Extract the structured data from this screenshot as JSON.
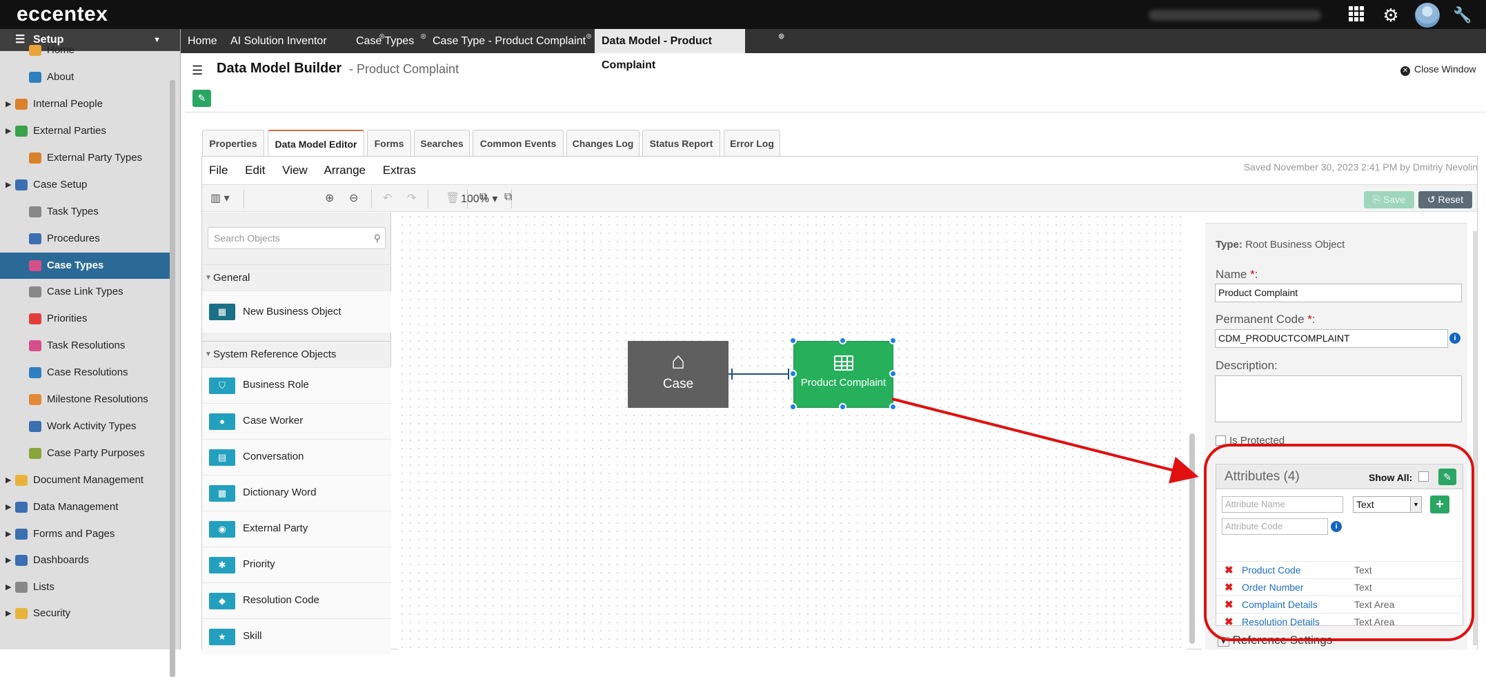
{
  "app": {
    "logo": "eccentex"
  },
  "sidebar": {
    "header": "Setup",
    "items": [
      {
        "label": "Home",
        "color": "#e8a33a"
      },
      {
        "label": "About",
        "color": "#2f7fc0"
      },
      {
        "label": "Internal People",
        "color": "#d9822b"
      },
      {
        "label": "External Parties",
        "color": "#3aa24b"
      },
      {
        "label": "External Party Types",
        "color": "#d9822b"
      },
      {
        "label": "Case Setup",
        "color": "#3c6fb0"
      },
      {
        "label": "Task Types",
        "color": "#888888"
      },
      {
        "label": "Procedures",
        "color": "#3c6fb0"
      },
      {
        "label": "Case Types",
        "color": "#d64f8a"
      },
      {
        "label": "Case Link Types",
        "color": "#888888"
      },
      {
        "label": "Priorities",
        "color": "#e23d3d"
      },
      {
        "label": "Task Resolutions",
        "color": "#d64f8a"
      },
      {
        "label": "Case Resolutions",
        "color": "#2f7fc0"
      },
      {
        "label": "Milestone Resolutions",
        "color": "#e28a3a"
      },
      {
        "label": "Work Activity Types",
        "color": "#3c6fb0"
      },
      {
        "label": "Case Party Purposes",
        "color": "#8aa53a"
      },
      {
        "label": "Document Management",
        "color": "#e8b33a"
      },
      {
        "label": "Data Management",
        "color": "#3c6fb0"
      },
      {
        "label": "Forms and Pages",
        "color": "#3c6fb0"
      },
      {
        "label": "Dashboards",
        "color": "#3c6fb0"
      },
      {
        "label": "Lists",
        "color": "#888888"
      },
      {
        "label": "Security",
        "color": "#e8b33a"
      }
    ]
  },
  "tabs": [
    {
      "label": "Home"
    },
    {
      "label": "AI Solution Inventor"
    },
    {
      "label": "Case Types"
    },
    {
      "label": "Case Type - Product Complaint"
    },
    {
      "label": "Data Model - Product Complaint"
    }
  ],
  "page": {
    "title": "Data Model Builder",
    "subtitle": "- Product Complaint",
    "close_label": "Close Window"
  },
  "prop_tabs": [
    "Properties",
    "Data Model Editor",
    "Forms",
    "Searches",
    "Common Events",
    "Changes Log",
    "Status Report",
    "Error Log"
  ],
  "menu": [
    "File",
    "Edit",
    "View",
    "Arrange",
    "Extras"
  ],
  "saved_text": "Saved November 30, 2023 2:41 PM by Dmitriy Nevolin",
  "toolbar": {
    "zoom": "100%",
    "save": "Save",
    "reset": "Reset"
  },
  "left_panel": {
    "search_placeholder": "Search Objects",
    "group_general": "General",
    "general_items": [
      {
        "label": "New Business Object",
        "icon": "table-icon"
      }
    ],
    "group_system": "System Reference Objects",
    "system_items": [
      {
        "label": "Business Role",
        "icon": "shield-icon",
        "glyph": "⛉"
      },
      {
        "label": "Case Worker",
        "icon": "person-icon",
        "glyph": "●"
      },
      {
        "label": "Conversation",
        "icon": "book-icon",
        "glyph": "▤"
      },
      {
        "label": "Dictionary Word",
        "icon": "document-icon",
        "glyph": "▦"
      },
      {
        "label": "External Party",
        "icon": "globe-icon",
        "glyph": "◉"
      },
      {
        "label": "Priority",
        "icon": "asterisk-icon",
        "glyph": "✱"
      },
      {
        "label": "Resolution Code",
        "icon": "tag-icon",
        "glyph": "◆"
      },
      {
        "label": "Skill",
        "icon": "star-icon",
        "glyph": "★"
      }
    ]
  },
  "canvas": {
    "node_case": "Case",
    "node_pc": "Product Complaint"
  },
  "props": {
    "type_label": "Type:",
    "type_value": "Root Business Object",
    "name_label": "Name",
    "name_value": "Product Complaint",
    "code_label": "Permanent Code",
    "code_value": "CDM_PRODUCTCOMPLAINT",
    "desc_label": "Description:",
    "protected_label": "Is Protected",
    "ref_settings": "Reference Settings"
  },
  "attributes": {
    "title": "Attributes (4)",
    "show_all": "Show All:",
    "name_placeholder": "Attribute Name",
    "code_placeholder": "Attribute Code",
    "type_selected": "Text",
    "rows": [
      {
        "name": "Product Code",
        "type": "Text"
      },
      {
        "name": "Order Number",
        "type": "Text"
      },
      {
        "name": "Complaint Details",
        "type": "Text Area"
      },
      {
        "name": "Resolution Details",
        "type": "Text Area"
      }
    ]
  },
  "colors": {
    "accent_green": "#2aa564",
    "active_blue": "#2b6a96",
    "annotation_red": "#e01010"
  }
}
